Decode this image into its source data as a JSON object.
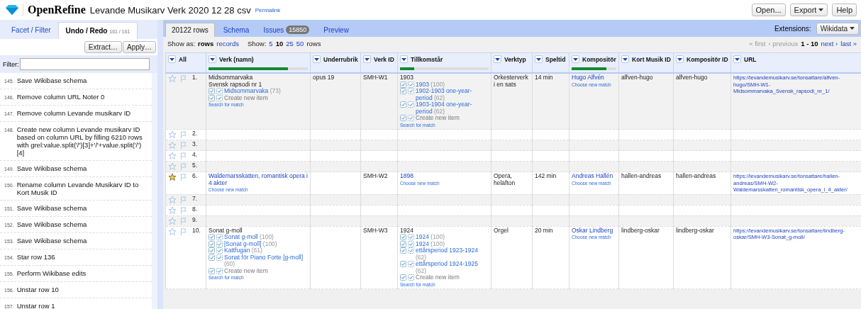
{
  "app": {
    "name": "OpenRefine",
    "project": "Levande Musikarv Verk 2020 12 28 csv",
    "permalink": "Permalink",
    "buttons": [
      {
        "label": "Open...",
        "dropdown": false
      },
      {
        "label": "Export",
        "dropdown": true
      },
      {
        "label": "Help",
        "dropdown": false
      }
    ]
  },
  "left_panel": {
    "tabs": [
      {
        "label": "Facet / Filter",
        "selected": false
      },
      {
        "label": "Undo / Redo",
        "count": "161 / 161",
        "selected": true
      }
    ],
    "actions": [
      "Extract…",
      "Apply…"
    ],
    "filter": {
      "label": "Filter:"
    },
    "history": [
      {
        "number": "145.",
        "text": "Save Wikibase schema"
      },
      {
        "number": "146.",
        "text": "Remove column URL Noter 0"
      },
      {
        "number": "147.",
        "text": "Remove column Levande musikarv ID"
      },
      {
        "number": "148.",
        "text": "Create new column Levande musikarv ID based on column URL by filling 6210 rows with grel:value.split('/')[3]+'/'+value.split('/')[4]"
      },
      {
        "number": "149.",
        "text": "Save Wikibase schema"
      },
      {
        "number": "150.",
        "text": "Rename column Levande Musikarv ID to Kort Musik ID"
      },
      {
        "number": "151.",
        "text": "Save Wikibase schema"
      },
      {
        "number": "152.",
        "text": "Save Wikibase schema"
      },
      {
        "number": "153.",
        "text": "Save Wikibase schema"
      },
      {
        "number": "154.",
        "text": "Star row 136"
      },
      {
        "number": "155.",
        "text": "Perform Wikibase edits"
      },
      {
        "number": "156.",
        "text": "Unstar row 10"
      },
      {
        "number": "157.",
        "text": "Unstar row 1"
      }
    ]
  },
  "main": {
    "tabs": [
      {
        "label": "20122 rows",
        "selected": true
      },
      {
        "label": "Schema",
        "selected": false
      },
      {
        "label": "Issues",
        "badge": "15850",
        "selected": false
      },
      {
        "label": "Preview",
        "selected": false
      }
    ],
    "extensions": {
      "label": "Extensions:",
      "menu": "Wikidata"
    },
    "show_as": {
      "label": "Show as:",
      "options": [
        {
          "label": "rows",
          "selected": true
        },
        {
          "label": "records",
          "selected": false
        }
      ]
    },
    "show": {
      "label": "Show:",
      "options": [
        {
          "label": "5",
          "selected": false
        },
        {
          "label": "10",
          "selected": true
        },
        {
          "label": "25",
          "selected": false
        },
        {
          "label": "50",
          "selected": false
        }
      ],
      "suffix": "rows"
    },
    "pager": [
      {
        "kind": "link",
        "label": "« first",
        "disabled": true
      },
      {
        "kind": "link",
        "label": "‹ previous",
        "disabled": true
      },
      {
        "kind": "range",
        "label": "1 - 10"
      },
      {
        "kind": "link",
        "label": "next ›",
        "disabled": false
      },
      {
        "kind": "link",
        "label": "last »",
        "disabled": false
      }
    ],
    "table": {
      "columns": [
        {
          "label": "All"
        },
        {
          "label": "Verk (namn)",
          "level": 0.8
        },
        {
          "label": "Underrubrik"
        },
        {
          "label": "Verk ID"
        },
        {
          "label": "Tillkomstår",
          "level": 0.16
        },
        {
          "label": "Verktyp"
        },
        {
          "label": "Speltid"
        },
        {
          "label": "Kompositör",
          "level": 0.78
        },
        {
          "label": "Kort Musik ID"
        },
        {
          "label": "Kompositör ID"
        },
        {
          "label": "URL"
        }
      ],
      "rows": [
        {
          "index": "1.",
          "starred": false,
          "cells": [
            {
              "kind": "recon",
              "text": "Midsommarvaka\nSvensk rapsodi nr 1",
              "candidates": [
                {
                  "name": "Midsommarvaka",
                  "score": "(73)"
                }
              ],
              "create": "Create new item",
              "action": "Search for match"
            },
            {
              "kind": "plain",
              "text": "opus 19"
            },
            {
              "kind": "plain",
              "text": "SMH-W1"
            },
            {
              "kind": "recon",
              "text": "1903",
              "candidates": [
                {
                  "name": "1903",
                  "score": "(100)"
                },
                {
                  "name": "1902-1903 one-year-period",
                  "score": "(62)"
                },
                {
                  "name": "1903-1904 one-year-period",
                  "score": "(62)"
                }
              ],
              "create": "Create new item",
              "action": "Search for match"
            },
            {
              "kind": "plain",
              "text": "Orkesterverk i en sats"
            },
            {
              "kind": "plain",
              "text": "14 min"
            },
            {
              "kind": "matched",
              "text": "Hugo Alfvén",
              "action": "Choose new match"
            },
            {
              "kind": "plain",
              "text": "alfven-hugo"
            },
            {
              "kind": "plain",
              "text": "alfven-hugo"
            },
            {
              "kind": "link",
              "text": "https://levandemusikarv.se/tonsattare/alfven-hugo/SMH-W1-Midsommarvaka_Svensk_rapsodi_nr_1/"
            }
          ]
        },
        {
          "index": "2.",
          "starred": false
        },
        {
          "index": "3.",
          "starred": false
        },
        {
          "index": "4.",
          "starred": false
        },
        {
          "index": "5.",
          "starred": false
        },
        {
          "index": "6.",
          "starred": true,
          "cells": [
            {
              "kind": "matched",
              "text": "Waldemarsskatten, romantisk opera i 4 akter",
              "action": "Choose new match"
            },
            {
              "kind": "empty"
            },
            {
              "kind": "plain",
              "text": "SMH-W2"
            },
            {
              "kind": "matched",
              "text": "1898",
              "action": "Choose new match"
            },
            {
              "kind": "plain",
              "text": "Opera, helafton"
            },
            {
              "kind": "plain",
              "text": "142 min"
            },
            {
              "kind": "matched",
              "text": "Andreas Hallén",
              "action": "Choose new match"
            },
            {
              "kind": "plain",
              "text": "hallen-andreas"
            },
            {
              "kind": "plain",
              "text": "hallen-andreas"
            },
            {
              "kind": "link",
              "text": "https://levandemusikarv.se/tonsattare/hallen-andreas/SMH-W2-Waldemarsskatten_romantisk_opera_i_4_akter/"
            }
          ]
        },
        {
          "index": "7.",
          "starred": false
        },
        {
          "index": "8.",
          "starred": false
        },
        {
          "index": "9.",
          "starred": false
        },
        {
          "index": "10.",
          "starred": false,
          "cells": [
            {
              "kind": "recon",
              "text": "Sonat g-moll",
              "candidates": [
                {
                  "name": "Sonat g-moll",
                  "score": "(100)"
                },
                {
                  "name": "[Sonat g-moll]",
                  "score": "(100)"
                },
                {
                  "name": "Kattfugan",
                  "score": "(61)"
                },
                {
                  "name": "Sonat för Piano Forte [g-moll]",
                  "score": "(60)"
                }
              ],
              "create": "Create new item",
              "action": "Search for match"
            },
            {
              "kind": "empty"
            },
            {
              "kind": "plain",
              "text": "SMH-W3"
            },
            {
              "kind": "recon",
              "text": "1924",
              "candidates": [
                {
                  "name": "1924",
                  "score": "(100)"
                },
                {
                  "name": "1924",
                  "score": "(100)"
                },
                {
                  "name": "ettårsperiod 1923-1924",
                  "score": "(62)"
                },
                {
                  "name": "ettårsperiod 1924-1925",
                  "score": "(62)"
                }
              ],
              "create": "Create new item",
              "action": "Search for match"
            },
            {
              "kind": "plain",
              "text": "Orgel"
            },
            {
              "kind": "plain",
              "text": "20 min"
            },
            {
              "kind": "matched",
              "text": "Oskar Lindberg",
              "action": "Choose new match"
            },
            {
              "kind": "plain",
              "text": "lindberg-oskar"
            },
            {
              "kind": "plain",
              "text": "lindberg-oskar"
            },
            {
              "kind": "link",
              "text": "https://levandemusikarv.se/tonsattare/lindberg-oskar/SMH-W3-Sonat_g-moll/"
            }
          ]
        }
      ]
    }
  }
}
